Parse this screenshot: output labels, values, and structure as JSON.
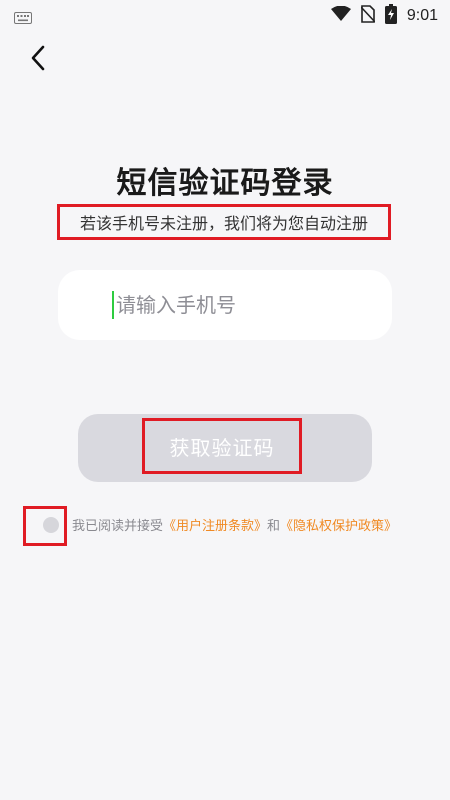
{
  "status_bar": {
    "time": "9:01",
    "icons": [
      "keyboard-icon",
      "wifi-icon",
      "no-sim-icon",
      "battery-charging-icon"
    ]
  },
  "header": {
    "back_icon": "chevron-left-icon"
  },
  "title": "短信验证码登录",
  "subtitle": "若该手机号未注册，我们将为您自动注册",
  "phone_input": {
    "placeholder": "请输入手机号",
    "value": ""
  },
  "get_code_button": {
    "label": "获取验证码"
  },
  "agreement": {
    "prefix": "我已阅读并接受",
    "user_terms": "《用户注册条款》",
    "and": "和",
    "privacy_policy": "《隐私权保护政策》",
    "checked": false
  },
  "colors": {
    "background": "#f6f6f8",
    "button_disabled": "#d9d9df",
    "link": "#f08a24",
    "highlight_box": "#e01b24",
    "cursor": "#2ecc40"
  }
}
